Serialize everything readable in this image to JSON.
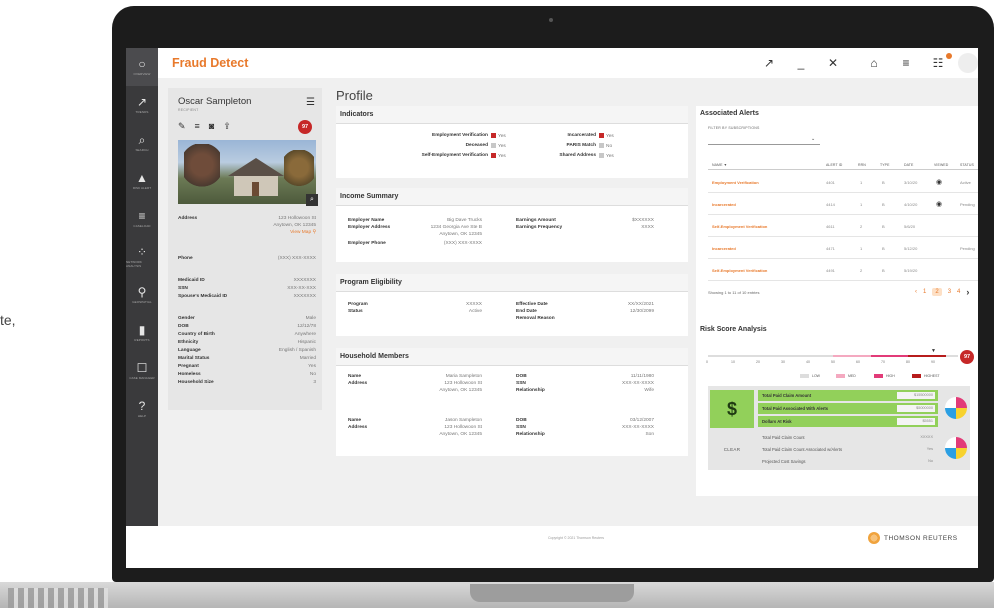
{
  "page": {
    "edge_text": "te,",
    "app_title": "Fraud Detect",
    "page_title": "Profile",
    "copyright": "Copyright © 2021 Thomson Reuters",
    "footer_logo_text": "THOMSON REUTERS"
  },
  "colors": {
    "accent": "#e8792b",
    "danger": "#c62828",
    "safe_green": "#92d05a",
    "rail": "#3a3a3c"
  },
  "rail": [
    {
      "icon": "○",
      "label": "OVERVIEW",
      "name": "rail-overview"
    },
    {
      "icon": "↗",
      "label": "TRENDS",
      "name": "rail-trends"
    },
    {
      "icon": "⌕",
      "label": "SEARCH",
      "name": "rail-search"
    },
    {
      "icon": "▲",
      "label": "RISK ALERT",
      "name": "rail-risk-alert"
    },
    {
      "icon": "≡",
      "label": "CASELOAD",
      "name": "rail-caseload"
    },
    {
      "icon": "⁘",
      "label": "NETWORK ANALYSIS",
      "name": "rail-network"
    },
    {
      "icon": "⚲",
      "label": "GEOSPATIAL",
      "name": "rail-geospatial"
    },
    {
      "icon": "▮",
      "label": "REPORTS",
      "name": "rail-reports"
    },
    {
      "icon": "☐",
      "label": "CASE MANAGER",
      "name": "rail-case-manager"
    },
    {
      "icon": "?",
      "label": "HELP",
      "name": "rail-help"
    }
  ],
  "top_actions": {
    "open_icon": "↗",
    "minimize": "_",
    "close": "✕",
    "briefcase": "⌂",
    "list": "≡",
    "notify": "☷"
  },
  "profile": {
    "name": "Oscar Sampleton",
    "role": "RECIPIENT",
    "risk_score": "97",
    "action_icons": [
      "✎",
      "≡",
      "◙",
      "⇪"
    ],
    "address_label": "Address",
    "address_line1": "123 Hollowoon St",
    "address_line2": "Anytown, OK 12345",
    "address_link": "View Map",
    "phone_label": "Phone",
    "phone": "(XXX) XXX-XXXX",
    "medicaid_label": "Medicaid ID",
    "medicaid": "XXXXXXX",
    "ssn_label": "SSN",
    "ssn": "XXX-XX-XXX",
    "spouse_label": "Spouse's Medicaid ID",
    "spouse": "XXXXXXX",
    "gender_label": "Gender",
    "gender": "Male",
    "dob_label": "DOB",
    "dob": "12/12/78",
    "country_label": "Country of Birth",
    "country": "Anywhere",
    "ethnicity_label": "Ethnicity",
    "ethnicity": "Hispanic",
    "language_label": "Language",
    "language": "English / Spanish",
    "marital_label": "Marital Status",
    "marital": "Married",
    "pregnant_label": "Pregnant",
    "pregnant": "Yes",
    "homeless_label": "Homeless",
    "homeless": "No",
    "household_label": "Household Size",
    "household": "3"
  },
  "indicators": {
    "title": "Indicators",
    "left": [
      {
        "label": "Employment Verification",
        "flag": "red",
        "value": "Yes"
      },
      {
        "label": "Deceased",
        "flag": "grey",
        "value": "Yes"
      },
      {
        "label": "Self-Employment Verification",
        "flag": "red",
        "value": "Yes"
      }
    ],
    "right": [
      {
        "label": "Incarcerated",
        "flag": "red",
        "value": "Yes"
      },
      {
        "label": "PARIS Match",
        "flag": "grey",
        "value": "No"
      },
      {
        "label": "Shared Address",
        "flag": "grey",
        "value": "Yes"
      }
    ]
  },
  "income": {
    "title": "Income Summary",
    "employer_name_label": "Employer Name",
    "employer_name": "Big Dave Trucks",
    "employer_addr_label": "Employer Address",
    "employer_addr_1": "1234 Georgia Ave Ste B",
    "employer_addr_2": "Anytown, OK 12345",
    "employer_phone_label": "Employer Phone",
    "employer_phone": "(XXX) XXX-XXXX",
    "earnings_label": "Earnings Amount",
    "earnings": "$XXXXXX",
    "frequency_label": "Earnings Frequency",
    "frequency": "XXXX"
  },
  "program": {
    "title": "Program Eligibility",
    "program_label": "Program",
    "program": "XXXXX",
    "status_label": "Status",
    "status": "Active",
    "effective_label": "Effective Date",
    "effective": "XX/XX/2021",
    "end_label": "End Date",
    "end": "12/30/2099",
    "removal_label": "Removal Reason",
    "removal": ""
  },
  "household": {
    "title": "Household Members",
    "members": [
      {
        "name_label": "Name",
        "name": "Maria Sampleton",
        "addr_label": "Address",
        "addr_1": "123 Hollowoon St",
        "addr_2": "Anytown, OK 12345",
        "dob_label": "DOB",
        "dob": "11/11/1980",
        "ssn_label": "SSN",
        "ssn": "XXX-XX-XXXX",
        "rel_label": "Relationship",
        "rel": "Wife"
      },
      {
        "name_label": "Name",
        "name": "Jason Sampleton",
        "addr_label": "Address",
        "addr_1": "123 Hollowoon St",
        "addr_2": "Anytown, OK 12345",
        "dob_label": "DOB",
        "dob": "03/12/2007",
        "ssn_label": "SSN",
        "ssn": "XXX-XX-XXXX",
        "rel_label": "Relationship",
        "rel": "Son"
      }
    ]
  },
  "alerts": {
    "title": "Associated Alerts",
    "filter_label": "FILTER BY SUBSCRIPTIONS",
    "columns": [
      "NAME ▼",
      "ALERT ID",
      "RRN",
      "TYPE",
      "DATE",
      "VIEWED",
      "STATUS"
    ],
    "rows": [
      {
        "name": "Employment Verification",
        "id": "4401",
        "rrn": "1",
        "type": "B",
        "date": "3/10/20",
        "viewed": true,
        "status": "Active"
      },
      {
        "name": "Incarcerated",
        "id": "4414",
        "rrn": "1",
        "type": "B",
        "date": "4/10/20",
        "viewed": true,
        "status": "Pending"
      },
      {
        "name": "Self-Employment Verification",
        "id": "4611",
        "rrn": "2",
        "type": "B",
        "date": "5/6/20",
        "viewed": false,
        "status": ""
      },
      {
        "name": "Incarcerated",
        "id": "4471",
        "rrn": "1",
        "type": "B",
        "date": "5/12/20",
        "viewed": false,
        "status": "Pending"
      },
      {
        "name": "Self-Employment Verification",
        "id": "4491",
        "rrn": "2",
        "type": "B",
        "date": "5/19/20",
        "viewed": false,
        "status": ""
      }
    ],
    "pager_text": "Showing 1 to 11 of 10 entries",
    "pages": [
      "‹",
      "1",
      "2",
      "3",
      "4",
      "›"
    ]
  },
  "risk": {
    "title": "Risk Score Analysis",
    "score": "97",
    "ticks": [
      "0",
      "10",
      "20",
      "30",
      "40",
      "50",
      "60",
      "70",
      "80",
      "90"
    ],
    "marker_value": 90,
    "legend": [
      {
        "label": "LOW",
        "color": "#dddddd"
      },
      {
        "label": "MED",
        "color": "#f4a9c0"
      },
      {
        "label": "HIGH",
        "color": "#e23b78"
      },
      {
        "label": "HIGHEST",
        "color": "#b71c1c"
      }
    ],
    "safe_symbol": "$",
    "clear_label": "CLEAR",
    "rows_green": [
      {
        "label": "Total Paid Claim Amount",
        "value": "$15500000"
      },
      {
        "label": "Total Paid Associated With Alerts",
        "value": "$5000000"
      },
      {
        "label": "Dollars At Risk",
        "value": "$5551"
      }
    ],
    "rows_plain": [
      {
        "label": "Total Paid Claim Count",
        "value": "XXXXX"
      },
      {
        "label": "Total Paid Claim Count Associated w/Alerts",
        "value": "Yes"
      },
      {
        "label": "Projected Cost Savings",
        "value": "No"
      }
    ],
    "pie_colors": [
      "#e23b78",
      "#f7d22e",
      "#2b9fe3",
      "#ffffff"
    ]
  }
}
